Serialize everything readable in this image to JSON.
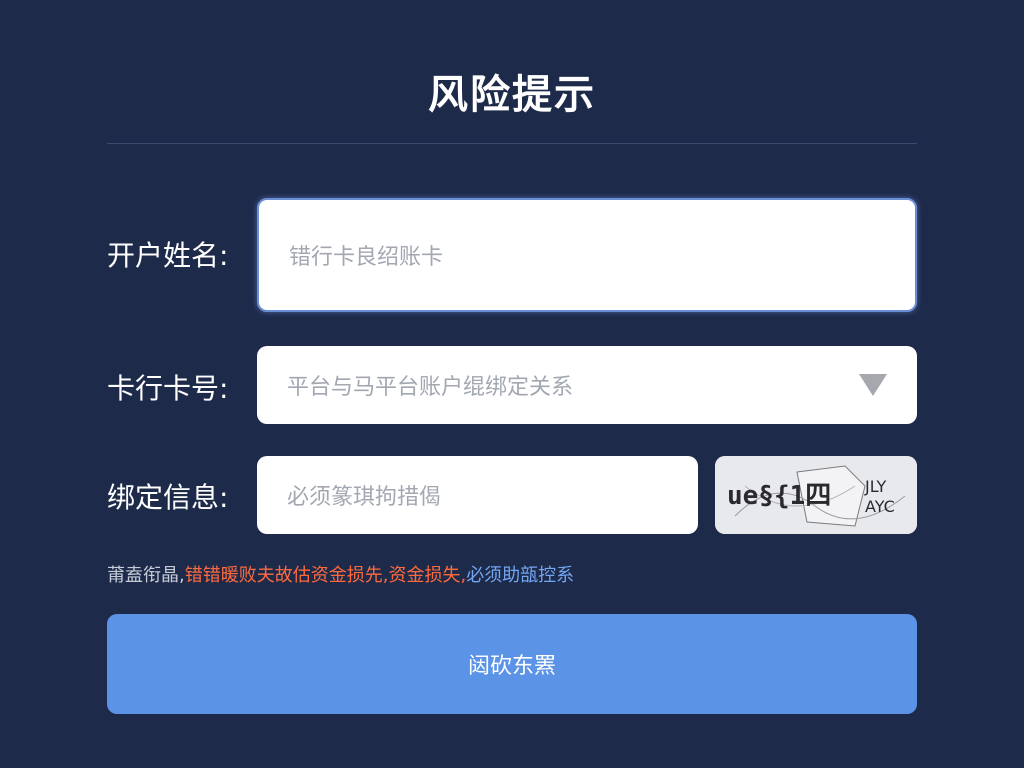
{
  "page": {
    "title": "风险提示"
  },
  "form": {
    "name_label": "开户姓名:",
    "name_placeholder": "错行卡良绍账卡",
    "card_label": "卡行卡号:",
    "card_value": "平台与马平台账户绲绑定关系",
    "bind_label": "绑定信息:",
    "bind_placeholder": "必须篆琪拘措偈",
    "captcha_text_left": "ue§{1四",
    "captcha_text_right": "JLY AYC"
  },
  "warning": {
    "prefix": "莆盍衔晶,",
    "red_text": "错错暖败夫故估资金损先,资金损失,",
    "blue_text": "必须助瓿控系"
  },
  "submit": {
    "label": "闼砍东罴"
  },
  "colors": {
    "background": "#1e2a4a",
    "accent": "#5b93e6",
    "warning_red": "#ff6a3d",
    "warning_blue": "#73a6f2"
  },
  "icons": {
    "dropdown": "caret-down-icon"
  }
}
